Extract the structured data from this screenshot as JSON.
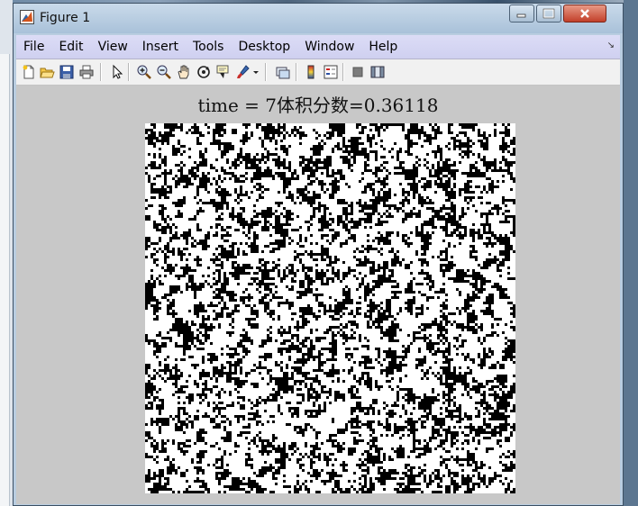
{
  "window": {
    "title": "Figure 1"
  },
  "menu": {
    "items": [
      "File",
      "Edit",
      "View",
      "Insert",
      "Tools",
      "Desktop",
      "Window",
      "Help"
    ]
  },
  "toolbar": {
    "buttons": [
      "new-figure-icon",
      "open-file-icon",
      "save-icon",
      "print-icon",
      "pointer-icon",
      "zoom-in-icon",
      "zoom-out-icon",
      "pan-icon",
      "rotate-3d-icon",
      "data-cursor-icon",
      "brush-icon",
      "link-plot-icon",
      "colorbar-icon",
      "legend-icon",
      "hide-plot-tools-icon",
      "show-plot-tools-icon"
    ]
  },
  "figure": {
    "title": "time = 7体积分数=0.36118",
    "volume_fraction": 0.36118,
    "time": 7,
    "image_colors": {
      "phase": "#000000",
      "background": "#ffffff"
    }
  }
}
